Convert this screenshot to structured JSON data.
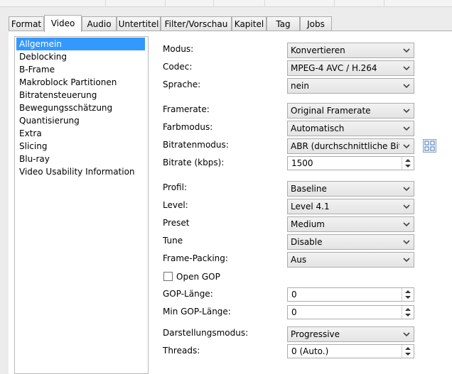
{
  "tabs": [
    "Format",
    "Video",
    "Audio",
    "Untertitel",
    "Filter/Vorschau",
    "Kapitel",
    "Tag",
    "Jobs"
  ],
  "active_tab": "Video",
  "nav_items": [
    "Allgemein",
    "Deblocking",
    "B-Frame",
    "Makroblock Partitionen",
    "Bitratensteuerung",
    "Bewegungsschätzung",
    "Quantisierung",
    "Extra",
    "Slicing",
    "Blu-ray",
    "Video Usability Information"
  ],
  "selected_nav": "Allgemein",
  "fields": {
    "modus": {
      "label": "Modus:",
      "value": "Konvertieren"
    },
    "codec": {
      "label": "Codec:",
      "value": "MPEG-4 AVC / H.264"
    },
    "sprache": {
      "label": "Sprache:",
      "value": "nein"
    },
    "framerate": {
      "label": "Framerate:",
      "value": "Original Framerate"
    },
    "farbmodus": {
      "label": "Farbmodus:",
      "value": "Automatisch"
    },
    "bitratenmodus": {
      "label": "Bitratenmodus:",
      "value": "ABR (durchschnittliche Bitrate)"
    },
    "bitrate": {
      "label": "Bitrate (kbps):",
      "value": "1500"
    },
    "profil": {
      "label": "Profil:",
      "value": "Baseline"
    },
    "level": {
      "label": "Level:",
      "value": "Level 4.1"
    },
    "preset": {
      "label": "Preset",
      "value": "Medium"
    },
    "tune": {
      "label": "Tune",
      "value": "Disable"
    },
    "frame_packing": {
      "label": "Frame-Packing:",
      "value": "Aus"
    },
    "open_gop": {
      "label": "Open GOP",
      "checked": false
    },
    "gop_laenge": {
      "label": "GOP-Länge:",
      "value": "0"
    },
    "min_gop_laenge": {
      "label": "Min GOP-Länge:",
      "value": "0"
    },
    "darstellungsmodus": {
      "label": "Darstellungsmodus:",
      "value": "Progressive"
    },
    "threads": {
      "label": "Threads:",
      "value": "0 (Auto.)"
    }
  }
}
